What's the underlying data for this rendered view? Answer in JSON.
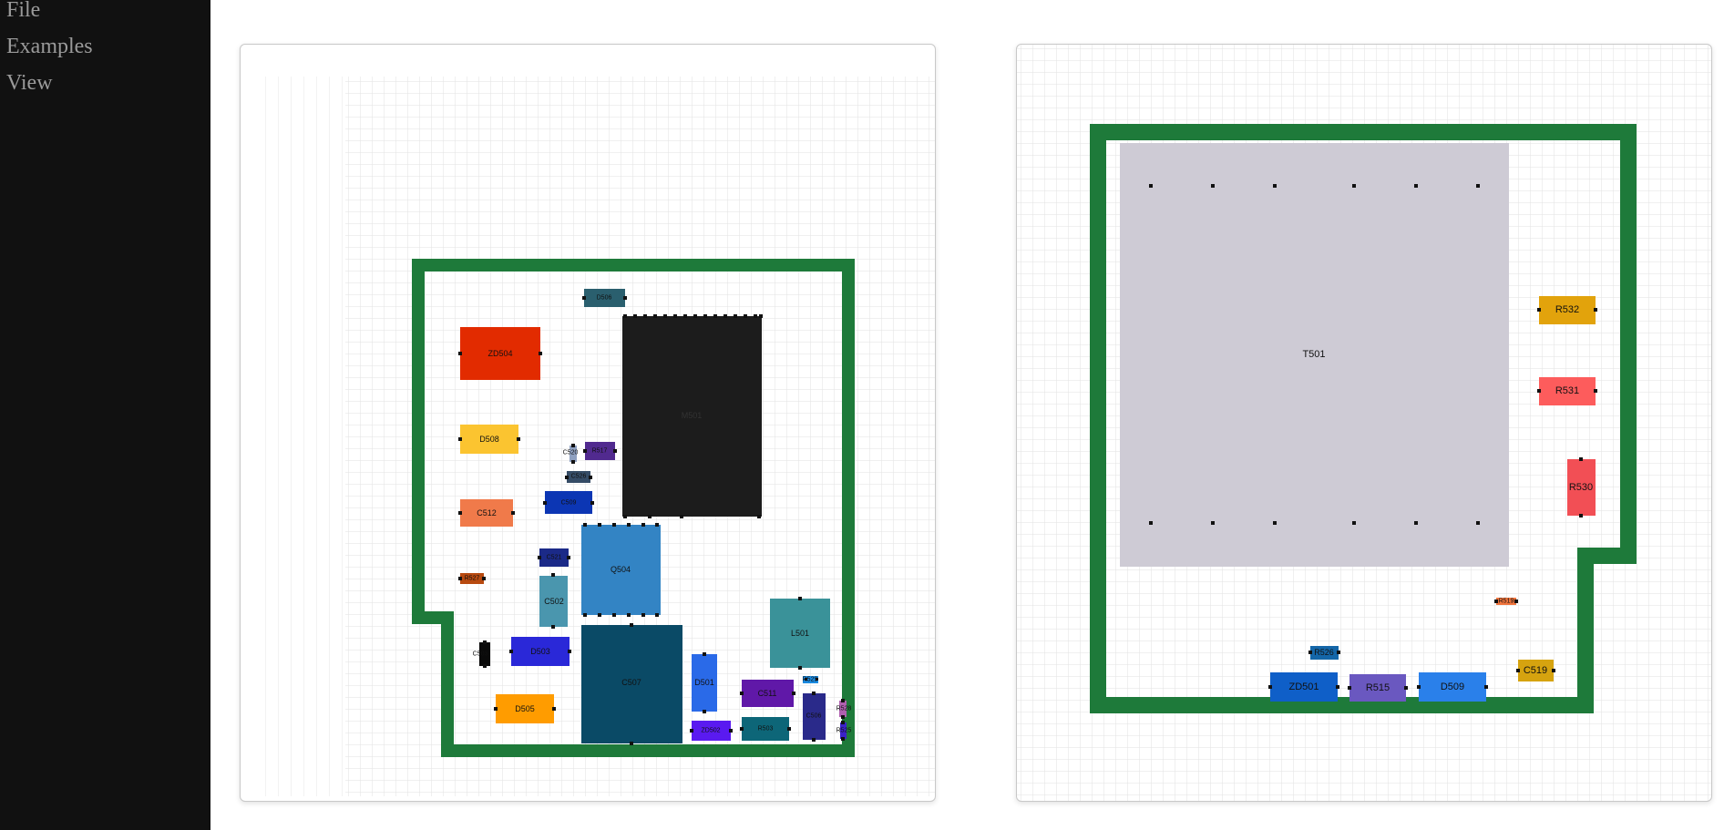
{
  "menu": {
    "items": [
      {
        "label": "File"
      },
      {
        "label": "Examples"
      },
      {
        "label": "View"
      }
    ]
  },
  "left_board": {
    "components": [
      "D506",
      "ZD504",
      "M501",
      "D508",
      "C520",
      "R517",
      "C526",
      "C509",
      "C512",
      "C521",
      "Q504",
      "C502",
      "R527",
      "C503",
      "D503",
      "L501",
      "C507",
      "D505",
      "D501",
      "C511",
      "R529",
      "C506",
      "ZD502",
      "R503",
      "R528",
      "R525"
    ]
  },
  "right_board": {
    "components": [
      "T501",
      "R532",
      "R531",
      "R530",
      "R519",
      "R526",
      "C519",
      "ZD501",
      "R515",
      "D509"
    ]
  },
  "colors": {
    "sidebar": "#111111",
    "board_outline": "#1e7a3a",
    "grid": "#e2e2e2",
    "menu_text": "#9a9a9a"
  }
}
